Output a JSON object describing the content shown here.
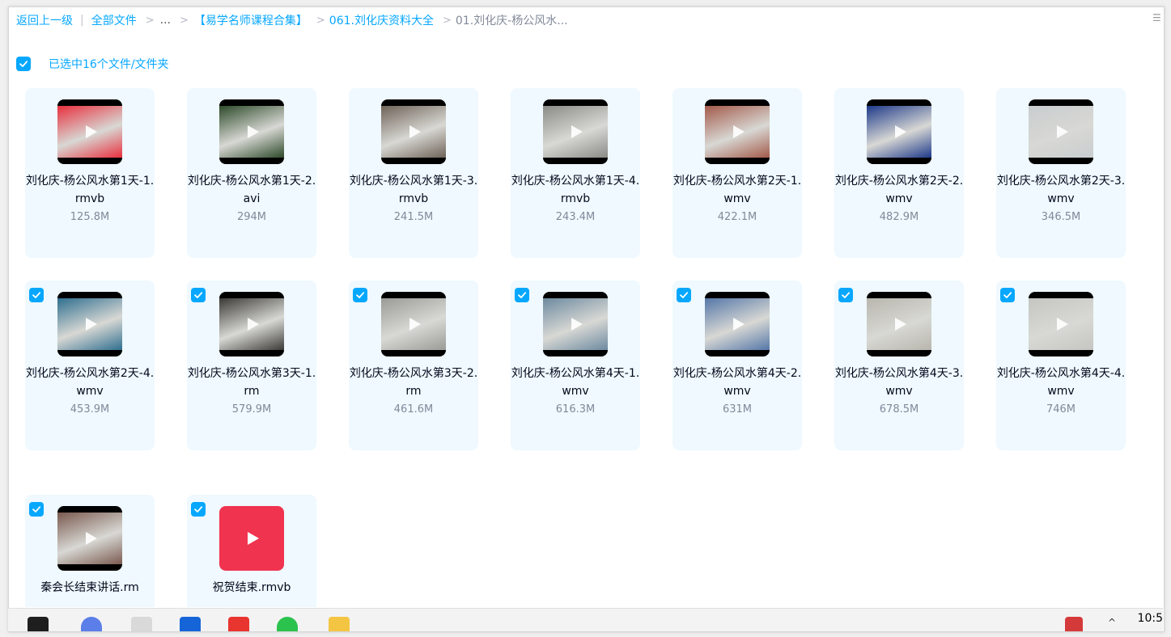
{
  "breadcrumb": {
    "back": "返回上一级",
    "all_files": "全部文件",
    "ellipsis": "...",
    "folder1": "【易学名师课程合集】",
    "folder2": "061.刘化庆资料大全",
    "current": "01.刘化庆-杨公风水..."
  },
  "selection": {
    "text": "已选中16个文件/文件夹"
  },
  "files": [
    {
      "name": "刘化庆-杨公风水第1天-1.rmvb",
      "size": "125.8M",
      "checked": false,
      "thumb": "#e8303e"
    },
    {
      "name": "刘化庆-杨公风水第1天-2.avi",
      "size": "294M",
      "checked": false,
      "thumb": "#2d4a2a"
    },
    {
      "name": "刘化庆-杨公风水第1天-3.rmvb",
      "size": "241.5M",
      "checked": false,
      "thumb": "#6f6358"
    },
    {
      "name": "刘化庆-杨公风水第1天-4.rmvb",
      "size": "243.4M",
      "checked": false,
      "thumb": "#8a8a86"
    },
    {
      "name": "刘化庆-杨公风水第2天-1.wmv",
      "size": "422.1M",
      "checked": false,
      "thumb": "#a35a4a"
    },
    {
      "name": "刘化庆-杨公风水第2天-2.wmv",
      "size": "482.9M",
      "checked": false,
      "thumb": "#1e3a8a"
    },
    {
      "name": "刘化庆-杨公风水第2天-3.wmv",
      "size": "346.5M",
      "checked": false,
      "thumb": "#c9cdd0"
    },
    {
      "name": "刘化庆-杨公风水第2天-4.wmv",
      "size": "453.9M",
      "checked": true,
      "thumb": "#2f6f8f"
    },
    {
      "name": "刘化庆-杨公风水第3天-1.rm",
      "size": "579.9M",
      "checked": true,
      "thumb": "#3b3a36"
    },
    {
      "name": "刘化庆-杨公风水第3天-2.rm",
      "size": "461.6M",
      "checked": true,
      "thumb": "#9a9a96"
    },
    {
      "name": "刘化庆-杨公风水第4天-1.wmv",
      "size": "616.3M",
      "checked": true,
      "thumb": "#6d8aa0"
    },
    {
      "name": "刘化庆-杨公风水第4天-2.wmv",
      "size": "631M",
      "checked": true,
      "thumb": "#5577a8"
    },
    {
      "name": "刘化庆-杨公风水第4天-3.wmv",
      "size": "678.5M",
      "checked": true,
      "thumb": "#b8b6ae"
    },
    {
      "name": "刘化庆-杨公风水第4天-4.wmv",
      "size": "746M",
      "checked": true,
      "thumb": "#c5c5c2"
    },
    {
      "name": "秦会长结束讲话.rm",
      "size": "",
      "checked": true,
      "thumb": "#7a5a50"
    },
    {
      "name": "祝贺结束.rmvb",
      "size": "",
      "checked": true,
      "thumb": "red-icon"
    }
  ],
  "taskbar": {
    "clock": "10:5"
  },
  "colors": {
    "accent": "#06a7ff",
    "card_bg": "#eff9ff"
  }
}
